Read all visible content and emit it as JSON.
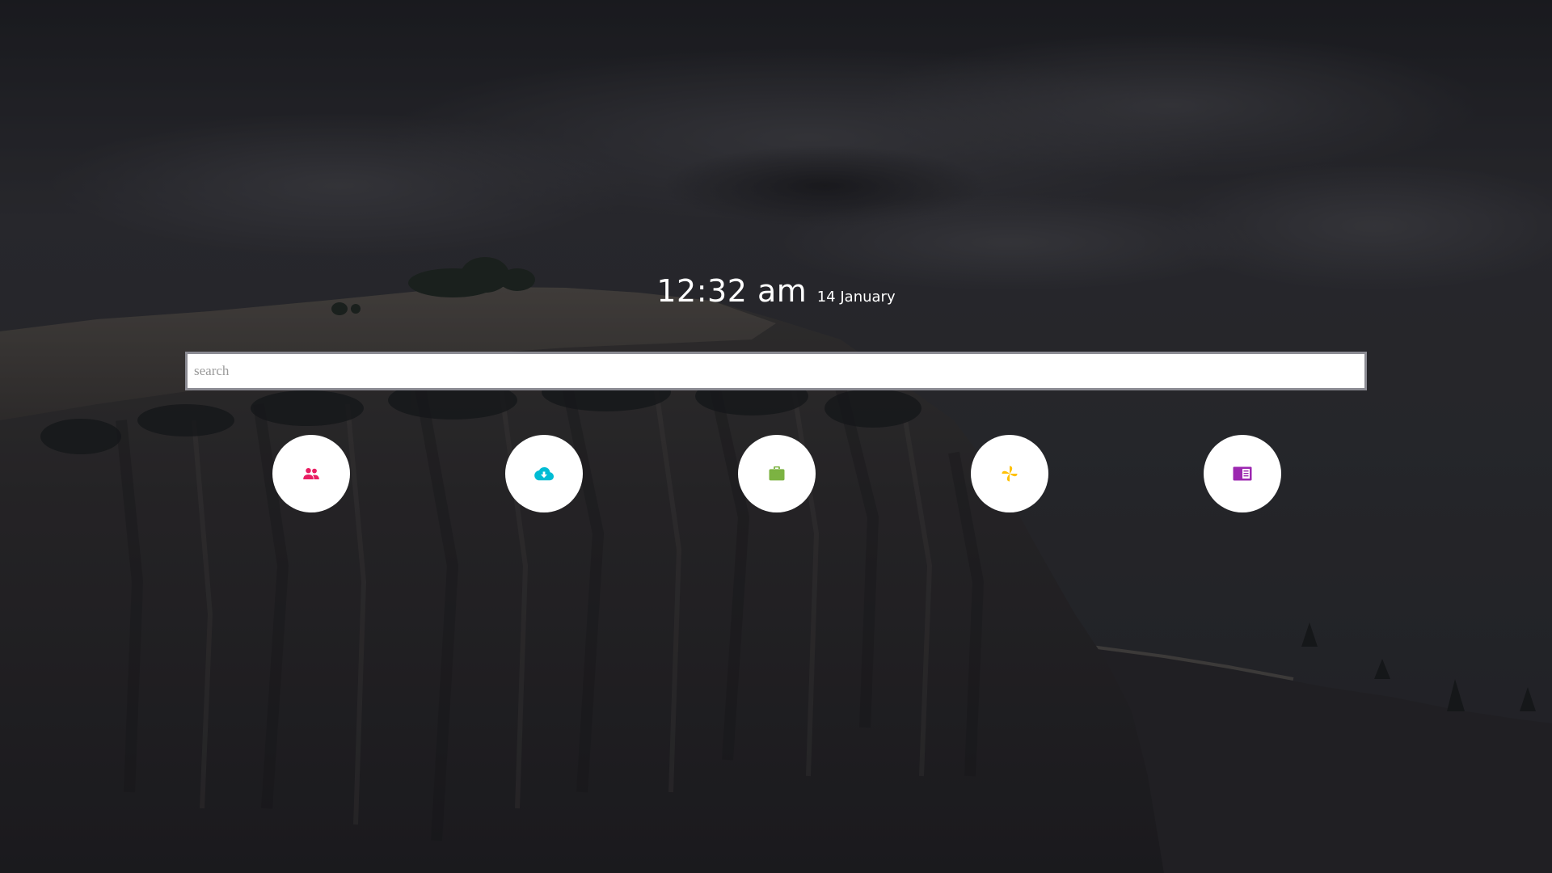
{
  "clock": {
    "time": "12:32 am",
    "date": "14 January"
  },
  "search": {
    "placeholder": "search",
    "value": ""
  },
  "shortcuts": [
    {
      "icon": "people-icon",
      "color": "#e91e63"
    },
    {
      "icon": "cloud-download-icon",
      "color": "#00bcd4"
    },
    {
      "icon": "briefcase-icon",
      "color": "#7cb342"
    },
    {
      "icon": "pinwheel-icon",
      "color": "#ffc107"
    },
    {
      "icon": "book-icon",
      "color": "#9c27b0"
    }
  ],
  "colors": {
    "overlay": "#202026",
    "circle": "#ffffff"
  }
}
